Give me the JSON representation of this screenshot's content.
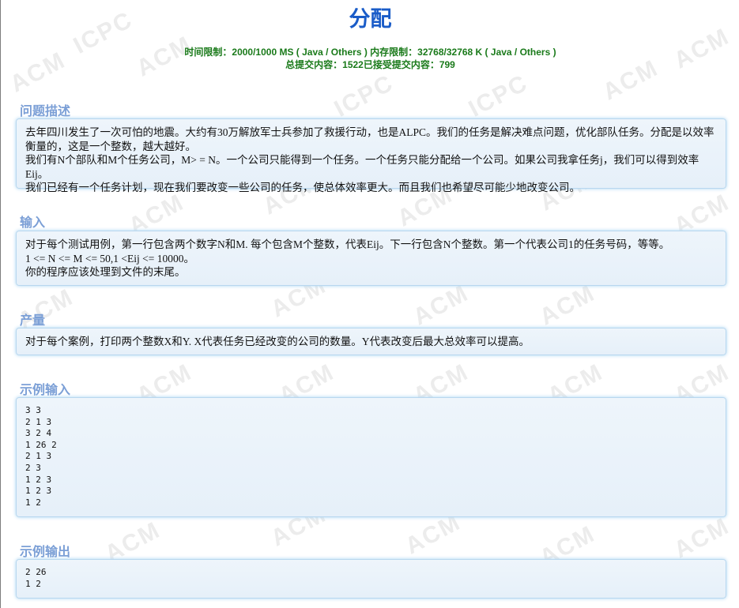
{
  "page": {
    "title": "分配",
    "limits_line1": "时间限制：2000/1000 MS ( Java / Others ) 内存限制：32768/32768 K ( Java / Others )",
    "limits_line2": "总提交内容：1522已接受提交内容：799",
    "watermarks": [
      "ACM",
      "ICPC"
    ]
  },
  "description": {
    "title": "问题描述",
    "lines": [
      "去年四川发生了一次可怕的地震。大约有30万解放军士兵参加了救援行动，也是ALPC。我们的任务是解决难点问题，优化部队任务。分配是以效率衡量的，这是一个整数，越大越好。",
      "我们有N个部队和M个任务公司，M> = N。一个公司只能得到一个任务。一个任务只能分配给一个公司。如果公司我拿任务j，我们可以得到效率Eij。",
      "我们已经有一个任务计划，现在我们要改变一些公司的任务，使总体效率更大。而且我们也希望尽可能少地改变公司。"
    ]
  },
  "input": {
    "title": "输入",
    "lines": [
      "对于每个测试用例，第一行包含两个数字N和M. 每个包含M个整数，代表Eij。下一行包含N个整数。第一个代表公司1的任务号码，等等。",
      "1 <= N <= M <= 50,1 <Eij <= 10000。",
      "你的程序应该处理到文件的末尾。"
    ]
  },
  "output": {
    "title": "产量",
    "lines": [
      "对于每个案例，打印两个整数X和Y. X代表任务已经改变的公司的数量。Y代表改变后最大总效率可以提高。"
    ]
  },
  "sample_input": {
    "title": "示例输入",
    "text": "3 3\n2 1 3\n3 2 4\n1 26 2\n2 1 3\n2 3\n1 2 3\n1 2 3\n1 2"
  },
  "sample_output": {
    "title": "示例输出",
    "text": "2 26\n1 2"
  }
}
